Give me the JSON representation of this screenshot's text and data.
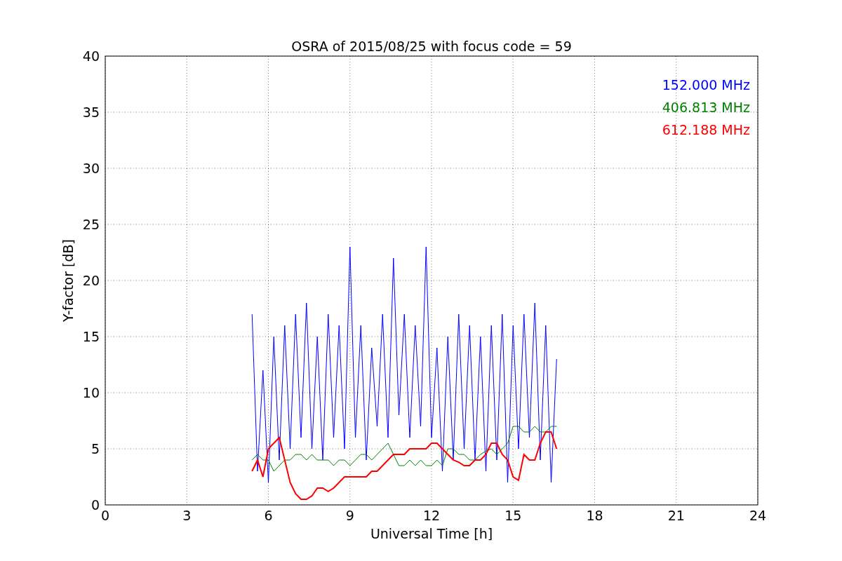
{
  "figure": {
    "chart_data": {
      "type": "line",
      "title": "OSRA of 2015/08/25 with focus code = 59",
      "xlabel": "Universal Time [h]",
      "ylabel": "Y-factor [dB]",
      "x": [
        5.4,
        5.6,
        5.8,
        6.0,
        6.2,
        6.4,
        6.6,
        6.8,
        7.0,
        7.2,
        7.4,
        7.6,
        7.8,
        8.0,
        8.2,
        8.4,
        8.6,
        8.8,
        9.0,
        9.2,
        9.4,
        9.6,
        9.8,
        10.0,
        10.2,
        10.4,
        10.6,
        10.8,
        11.0,
        11.2,
        11.4,
        11.6,
        11.8,
        12.0,
        12.2,
        12.4,
        12.6,
        12.8,
        13.0,
        13.2,
        13.4,
        13.6,
        13.8,
        14.0,
        14.2,
        14.4,
        14.6,
        14.8,
        15.0,
        15.2,
        15.4,
        15.6,
        15.8,
        16.0,
        16.2,
        16.4,
        16.6
      ],
      "series": [
        {
          "name": "152.000 MHz",
          "color": "#0000ff",
          "values": [
            17,
            3,
            12,
            2,
            15,
            4,
            16,
            5,
            17,
            6,
            18,
            5,
            15,
            4,
            17,
            6,
            16,
            5,
            23,
            6,
            16,
            4,
            14,
            7,
            17,
            6,
            22,
            8,
            17,
            6,
            16,
            7,
            23,
            6,
            14,
            3,
            15,
            4,
            17,
            5,
            16,
            4,
            15,
            3,
            16,
            4,
            17,
            2,
            16,
            5,
            17,
            6,
            18,
            4,
            16,
            2,
            13
          ]
        },
        {
          "name": "406.813 MHz",
          "color": "#008000",
          "values": [
            4,
            4.5,
            4,
            4,
            3,
            3.5,
            4,
            4,
            4.5,
            4.5,
            4,
            4.5,
            4,
            4,
            4,
            3.5,
            4,
            4,
            3.5,
            4,
            4.5,
            4.5,
            4,
            4.5,
            5,
            5.5,
            4.5,
            3.5,
            3.5,
            4,
            3.5,
            4,
            3.5,
            3.5,
            4,
            3.5,
            5,
            5,
            4.5,
            4.5,
            4,
            4,
            4.5,
            4.8,
            5,
            4.5,
            5,
            5.5,
            7,
            7,
            6.5,
            6.5,
            7,
            6.5,
            6.5,
            7,
            7
          ]
        },
        {
          "name": "612.188 MHz",
          "color": "#ff0000",
          "values": [
            3,
            4,
            2.5,
            5,
            5.5,
            6,
            4,
            2,
            1,
            0.5,
            0.5,
            0.8,
            1.5,
            1.5,
            1.2,
            1.5,
            2,
            2.5,
            2.5,
            2.5,
            2.5,
            2.5,
            3,
            3,
            3.5,
            4,
            4.5,
            4.5,
            4.5,
            5,
            5,
            5,
            5,
            5.5,
            5.5,
            5,
            4.5,
            4,
            3.8,
            3.5,
            3.5,
            4,
            4,
            4.5,
            5.5,
            5.5,
            4.5,
            4,
            2.5,
            2.2,
            4.5,
            4,
            4,
            5.5,
            6.5,
            6.5,
            5
          ]
        }
      ],
      "xlim": [
        0,
        24
      ],
      "ylim": [
        0,
        40
      ],
      "xticks": [
        0,
        3,
        6,
        9,
        12,
        15,
        18,
        21,
        24
      ],
      "yticks": [
        0,
        5,
        10,
        15,
        20,
        25,
        30,
        35,
        40
      ],
      "grid": true
    }
  }
}
